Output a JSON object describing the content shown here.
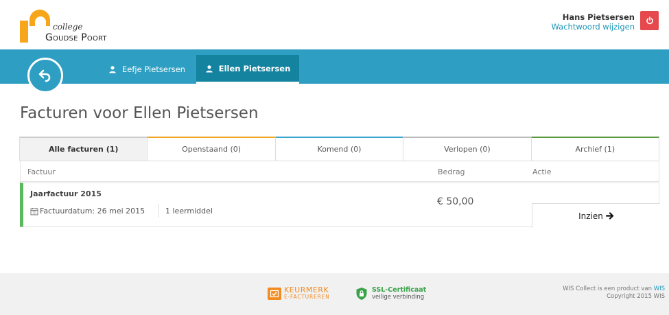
{
  "brand": {
    "line1": "college",
    "line2": "Goudse Poort"
  },
  "user": {
    "name": "Hans Pietsersen",
    "change_password": "Wachtwoord wijzigen",
    "logout_icon": "power-icon"
  },
  "nav": {
    "back_icon": "back-arrow-icon",
    "children": [
      {
        "label": "Eefje Pietsersen",
        "active": false,
        "icon": "person-icon"
      },
      {
        "label": "Ellen Pietsersen",
        "active": true,
        "icon": "person-icon"
      }
    ]
  },
  "page": {
    "title": "Facturen voor Ellen Pietsersen"
  },
  "filters": [
    {
      "label": "Alle facturen (1)",
      "active": true
    },
    {
      "label": "Openstaand (0)",
      "color": "#f0a427"
    },
    {
      "label": "Komend (0)",
      "color": "#3aa6cf"
    },
    {
      "label": "Verlopen (0)",
      "color": "#bbbbbb"
    },
    {
      "label": "Archief (1)",
      "color": "#5a9a3f"
    }
  ],
  "table": {
    "columns": [
      "Factuur",
      "Bedrag",
      "Actie"
    ],
    "rows": [
      {
        "title": "Jaarfactuur 2015",
        "date": "Factuurdatum: 26 mei 2015",
        "items": "1 leermiddel",
        "amount": "€ 50,00",
        "action": "Inzien",
        "status_color": "#5cb85c"
      }
    ]
  },
  "footer": {
    "keurmerk_top": "KEURMERK",
    "keurmerk_bottom": "E-FACTUREREN",
    "ssl_title": "SSL-Certificaat",
    "ssl_sub": "veilige verbinding",
    "credit_text": "WIS Collect is een product van ",
    "credit_link": "WIS",
    "copyright": "Copyright 2015 WIS"
  },
  "colors": {
    "primary": "#2e9fc2",
    "primary_dark": "#14839f",
    "brand_orange": "#f7a51b",
    "logout_red": "#e5484d"
  }
}
